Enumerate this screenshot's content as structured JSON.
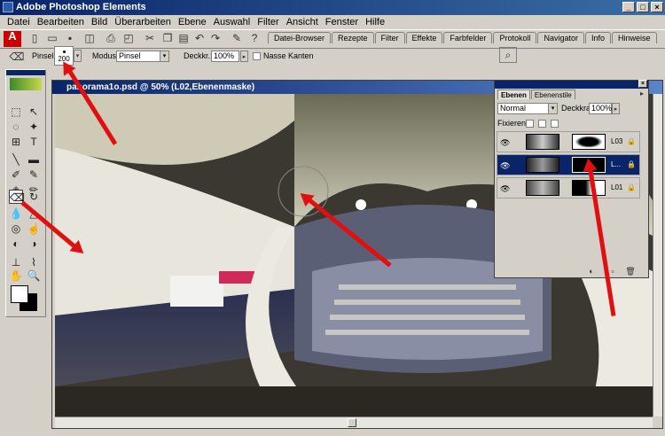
{
  "window": {
    "title": "Adobe Photoshop Elements"
  },
  "menu": [
    "Datei",
    "Bearbeiten",
    "Bild",
    "Überarbeiten",
    "Ebene",
    "Auswahl",
    "Filter",
    "Ansicht",
    "Fenster",
    "Hilfe"
  ],
  "palette_tabs": [
    "Datei-Browser",
    "Rezepte",
    "Filter",
    "Effekte",
    "Farbfelder",
    "Protokoll",
    "Navigator",
    "Info",
    "Hinweise"
  ],
  "options": {
    "brush_label": "Pinsel:",
    "brush_size": "200",
    "mode_label": "Modus:",
    "mode_value": "Pinsel",
    "opacity_label": "Deckkr.:",
    "opacity_value": "100%",
    "wet_edges_label": "Nasse Kanten"
  },
  "document": {
    "title": "panorama1o.psd @ 50% (L02,Ebenenmaske)"
  },
  "layers_palette": {
    "tabs": [
      "Ebenen",
      "Ebenenstile"
    ],
    "blend_mode": "Normal",
    "opacity_label": "Deckkraft:",
    "opacity_value": "100%",
    "lock_label": "Fixieren:",
    "layers": [
      {
        "name": "L03"
      },
      {
        "name": "L..."
      },
      {
        "name": "L01"
      }
    ]
  },
  "accent": {
    "titlebar": "#0a246a",
    "arrow": "#e01010"
  }
}
